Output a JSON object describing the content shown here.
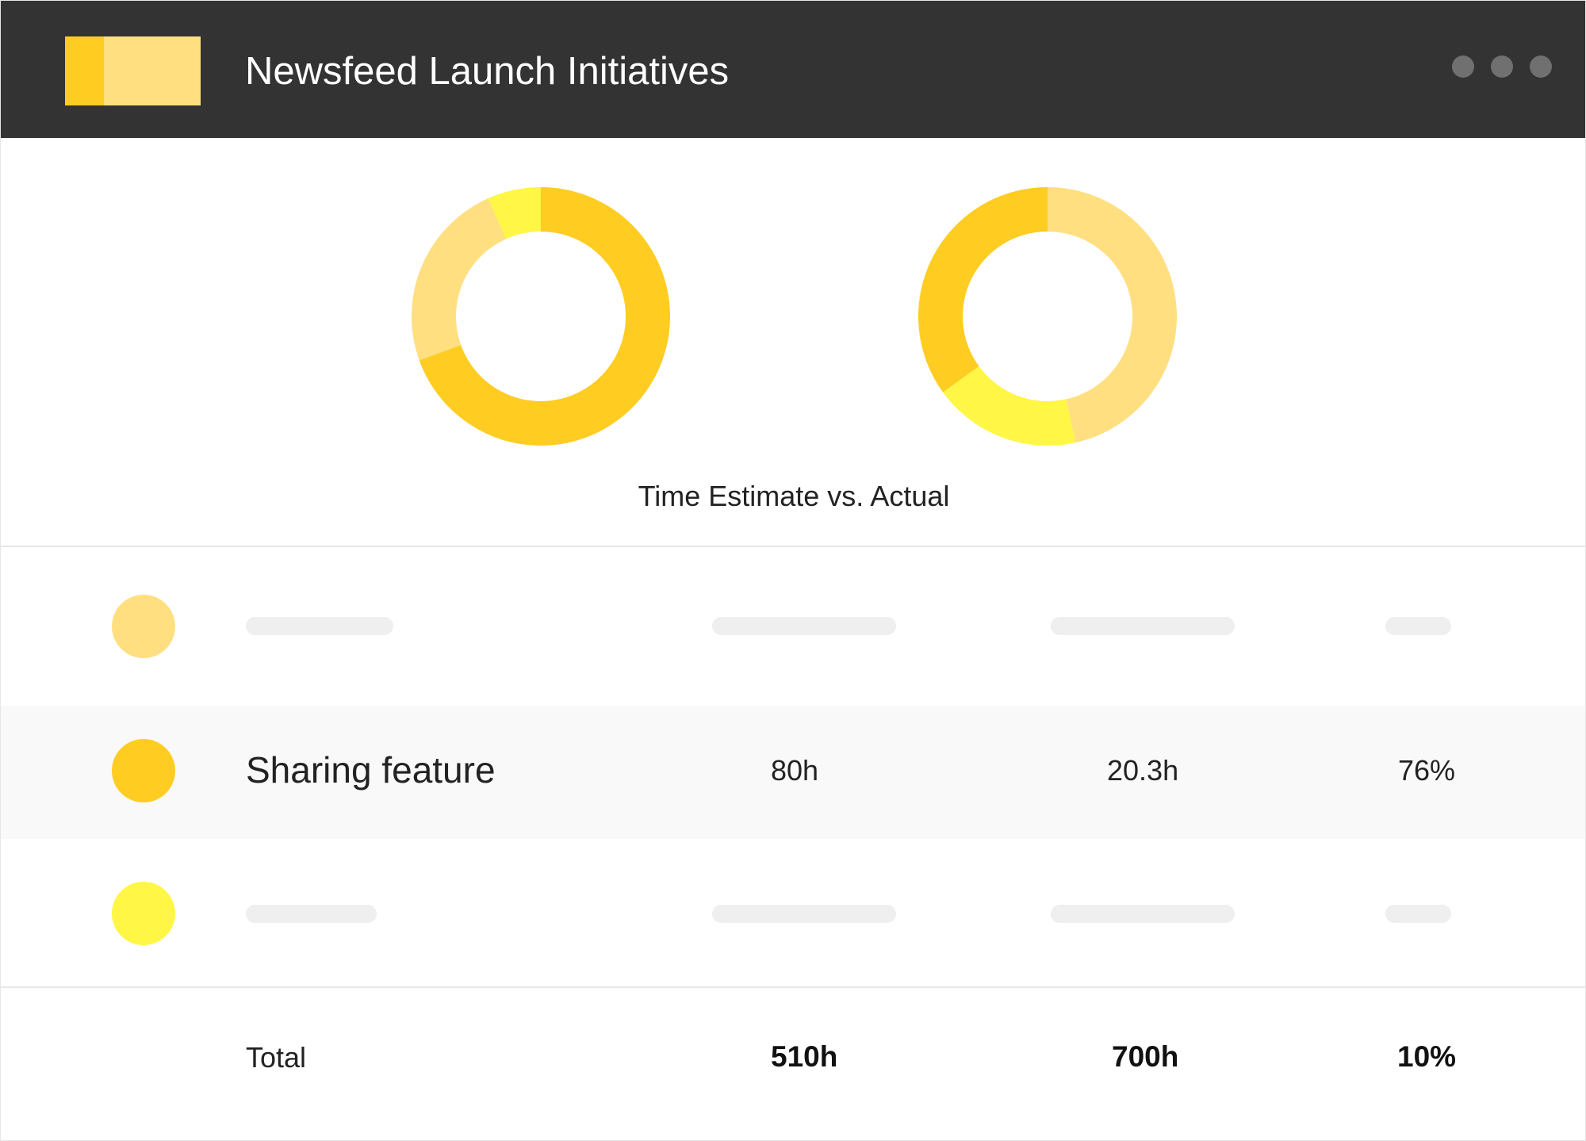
{
  "app": {
    "title": "Newsfeed Launch Initiatives",
    "window_controls": [
      "more-dot",
      "more-dot",
      "more-dot"
    ],
    "logo_colors": [
      "#FFCC22",
      "#FFDF80"
    ]
  },
  "colors": {
    "dark_gold": "#FFCC22",
    "light_gold": "#FFDF80",
    "bright_yellow": "#FFF645",
    "title_bar": "#333333"
  },
  "chart_data": {
    "type": "pie",
    "subtype": "donut",
    "title": "Time Estimate vs. Actual",
    "charts": [
      {
        "slices": [
          {
            "color": "#FFCC22",
            "percent": 69.5
          },
          {
            "color": "#FFDF80",
            "percent": 23.8
          },
          {
            "color": "#FFF645",
            "percent": 6.7
          }
        ]
      },
      {
        "slices": [
          {
            "color": "#FFDF80",
            "percent": 46.5
          },
          {
            "color": "#FFF645",
            "percent": 18.5
          },
          {
            "color": "#FFCC22",
            "percent": 35.0
          }
        ]
      }
    ]
  },
  "table": {
    "rows": [
      {
        "swatch": "#FFDF80",
        "placeholder": true
      },
      {
        "swatch": "#FFCC22",
        "name": "Sharing feature",
        "estimate": "80h",
        "actual": "20.3h",
        "percent": "76%"
      },
      {
        "swatch": "#FFF645",
        "placeholder": true
      }
    ],
    "total": {
      "label": "Total",
      "estimate": "510h",
      "actual": "700h",
      "percent": "10%"
    }
  }
}
